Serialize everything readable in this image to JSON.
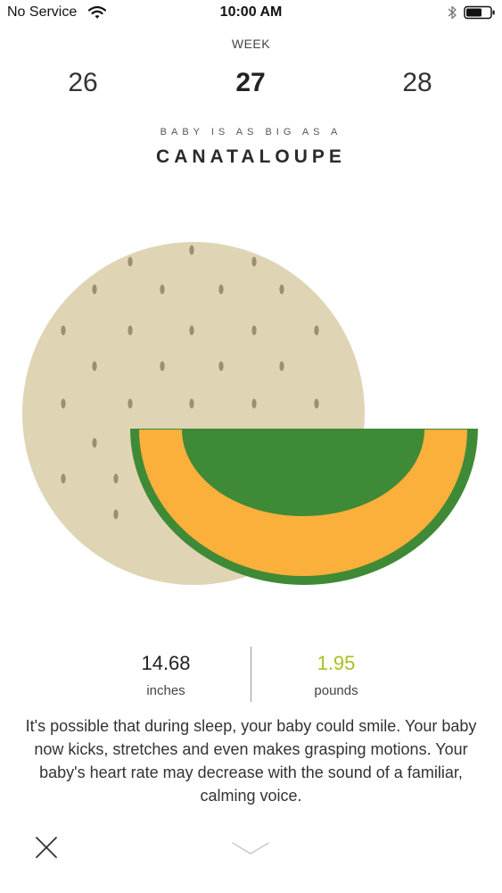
{
  "status_bar": {
    "carrier": "No Service",
    "time": "10:00 AM"
  },
  "week": {
    "label": "WEEK",
    "previous": "26",
    "current": "27",
    "next": "28"
  },
  "fruit": {
    "caption": "BABY IS AS BIG AS A",
    "name": "CANATALOUPE",
    "colors": {
      "rind": "#dfd4b4",
      "seed": "#9b8f71",
      "flesh": "#fbb03b",
      "skin": "#3f8a37"
    }
  },
  "stats": {
    "length_value": "14.68",
    "length_unit": "inches",
    "weight_value": "1.95",
    "weight_unit": "pounds"
  },
  "description": "It's possible that during sleep, your baby could smile. Your baby now kicks, stretches and even makes grasping motions. Your baby's heart rate may decrease with the sound of a familiar, calming voice.",
  "footer": {
    "close_icon": "close-icon",
    "down_icon": "chevron-down-icon"
  }
}
